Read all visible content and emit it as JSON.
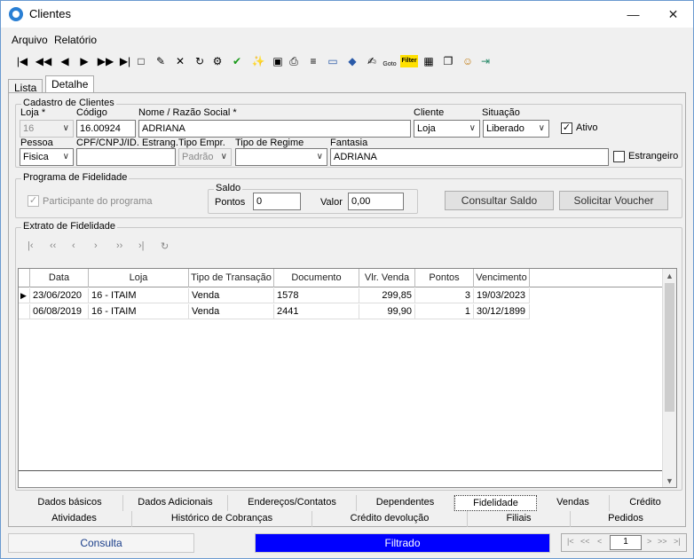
{
  "window": {
    "title": "Clientes",
    "minimize": "—",
    "maximize": "☐",
    "close": "✕"
  },
  "menu": [
    "Arquivo",
    "Relatório"
  ],
  "toolbar": {
    "icons": [
      "first-record-icon",
      "prev-page-icon",
      "prev-record-icon",
      "next-record-icon",
      "next-page-icon",
      "last-record-icon",
      "new-icon",
      "edit-icon",
      "delete-icon",
      "refresh-icon",
      "properties-icon",
      "confirm-icon",
      "wand-icon",
      "preview-icon",
      "print-icon",
      "report-icon",
      "card-icon",
      "tag-icon",
      "pen-icon",
      "goto-icon",
      "filter-icon",
      "calendar-icon",
      "copy-icon",
      "user-icon",
      "exit-icon"
    ],
    "glyphs": [
      "|◀",
      "◀◀",
      "◀",
      "▶",
      "▶▶",
      "▶|",
      "□",
      "✎",
      "✕",
      "↻",
      "⚙",
      "✔",
      "✨",
      "▣",
      "⎙",
      "≡",
      "▭",
      "◆",
      "✍",
      "",
      "",
      "▦",
      "❐",
      "☺",
      "⇥"
    ],
    "goto_label": "Goto",
    "filter_label": "Filter"
  },
  "tabs": {
    "lista": "Lista",
    "detalhe": "Detalhe"
  },
  "cadastro": {
    "title": "Cadastro de Clientes",
    "loja_label": "Loja *",
    "loja_value": "16",
    "codigo_label": "Código",
    "codigo_value": "16.00924",
    "nome_label": "Nome / Razão Social *",
    "nome_value": "ADRIANA",
    "cliente_label": "Cliente",
    "cliente_value": "Loja",
    "situacao_label": "Situação",
    "situacao_value": "Liberado",
    "ativo_label": "Ativo",
    "ativo_mark": "✓",
    "pessoa_label": "Pessoa",
    "pessoa_value": "Fisica",
    "cpf_label": "CPF/CNPJ/ID. Estrang.",
    "cpf_value": "",
    "tipo_empr_label": "Tipo Empr.",
    "tipo_empr_value": "Padrão",
    "tipo_regime_label": "Tipo de Regime",
    "tipo_regime_value": "",
    "fantasia_label": "Fantasia",
    "fantasia_value": "ADRIANA",
    "estrangeiro_label": "Estrangeiro"
  },
  "fidelidade": {
    "title": "Programa de Fidelidade",
    "participante_label": "Participante do programa",
    "participante_mark": "✓",
    "saldo_title": "Saldo",
    "pontos_label": "Pontos",
    "pontos_value": "0",
    "valor_label": "Valor",
    "valor_value": "0,00",
    "consultar_btn": "Consultar Saldo",
    "voucher_btn": "Solicitar Voucher"
  },
  "extrato": {
    "title": "Extrato de Fidelidade",
    "nav_glyphs": [
      "|‹",
      "‹‹",
      "‹",
      "›",
      "››",
      "›|",
      "↻"
    ],
    "columns": [
      "Data",
      "Loja",
      "Tipo de Transação",
      "Documento",
      "Vlr. Venda",
      "Pontos",
      "Vencimento"
    ],
    "rows": [
      [
        "23/06/2020",
        "16 - ITAIM",
        "Venda",
        "1578",
        "299,85",
        "3",
        "19/03/2023"
      ],
      [
        "06/08/2019",
        "16 - ITAIM",
        "Venda",
        "2441",
        "99,90",
        "1",
        "30/12/1899"
      ]
    ],
    "row_indicator": "▶",
    "scroll_up": "▲",
    "scroll_down": "▼"
  },
  "bottom_tabs": {
    "row1": [
      "Dados básicos",
      "Dados Adicionais",
      "Endereços/Contatos",
      "Dependentes",
      "Fidelidade",
      "Vendas",
      "Crédito"
    ],
    "row2": [
      "Atividades",
      "Histórico de Cobranças",
      "Crédito devolução",
      "Filiais",
      "Pedidos"
    ]
  },
  "status": {
    "mode": "Consulta",
    "filter": "Filtrado",
    "filter_color": "#0000ff"
  },
  "pager": {
    "glyphs": [
      "|<",
      "<<",
      "<",
      ">",
      ">>",
      ">|"
    ],
    "page": "1"
  }
}
